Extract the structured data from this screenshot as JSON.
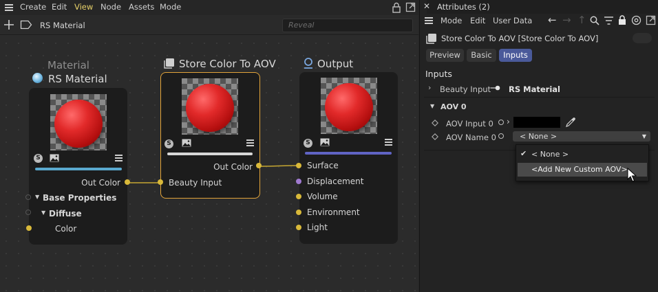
{
  "editor": {
    "menu": [
      "Create",
      "Edit",
      "View",
      "Node",
      "Assets",
      "Mode"
    ],
    "active_menu": "View",
    "breadcrumb": "RS Material",
    "reveal_placeholder": "Reveal"
  },
  "nodes": {
    "rs_material": {
      "group_label": "Material",
      "title": "RS Material",
      "output_port": "Out Color",
      "rows": [
        "Base Properties",
        "Diffuse",
        "Color"
      ],
      "accent": "#5aa9cf"
    },
    "store_color": {
      "title": "Store Color To AOV",
      "output_port": "Out Color",
      "input_port": "Beauty Input",
      "accent": "#d8d8d8"
    },
    "output": {
      "title": "Output",
      "inputs": [
        "Surface",
        "Displacement",
        "Volume",
        "Environment",
        "Light"
      ],
      "accent": "#6064c4"
    }
  },
  "attributes": {
    "panel_title": "Attributes (2)",
    "menu": [
      "Mode",
      "Edit",
      "User Data"
    ],
    "object_title": "Store Color To AOV [Store Color To AOV]",
    "tabs": [
      "Preview",
      "Basic",
      "Inputs"
    ],
    "active_tab": "Inputs",
    "section": "Inputs",
    "beauty_input_label": "Beauty Input",
    "beauty_input_value": "RS Material",
    "group": "AOV 0",
    "aov_input_label": "AOV Input 0",
    "aov_input_color": "#000000",
    "aov_name_label": "AOV Name 0",
    "aov_name_value": "< None >",
    "dropdown_options": [
      "< None >",
      "<Add New Custom AOV>"
    ],
    "selected_option": "< None >",
    "hovered_option": "<Add New Custom AOV>"
  }
}
